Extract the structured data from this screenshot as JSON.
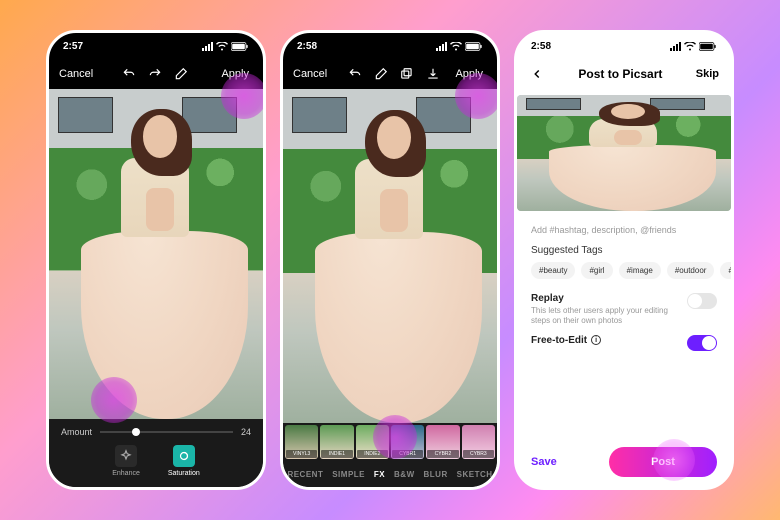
{
  "phone1": {
    "time": "2:57",
    "cancel": "Cancel",
    "apply": "Apply",
    "amount_label": "Amount",
    "amount_value": "24",
    "slider_percent": 24,
    "tools": {
      "enhance": "Enhance",
      "saturation": "Saturation"
    }
  },
  "phone2": {
    "time": "2:58",
    "cancel": "Cancel",
    "apply": "Apply",
    "thumbs": [
      "VINYL3",
      "INDIE1",
      "INDIE2",
      "CYBR1",
      "CYBR2",
      "CYBR3"
    ],
    "categories": [
      "RECENT",
      "SIMPLE",
      "FX",
      "B&W",
      "BLUR",
      "SKETCH"
    ],
    "active_category": "FX"
  },
  "phone3": {
    "time": "2:58",
    "title": "Post to Picsart",
    "skip": "Skip",
    "hashtag_placeholder": "Add #hashtag, description, @friends",
    "suggested_label": "Suggested Tags",
    "tags": [
      "#beauty",
      "#girl",
      "#image",
      "#outdoor",
      "#afternoon"
    ],
    "replay": {
      "title": "Replay",
      "desc": "This lets other users apply your editing steps on their own photos",
      "on": false
    },
    "free_to_edit": {
      "title": "Free-to-Edit",
      "on": true
    },
    "save": "Save",
    "post": "Post"
  },
  "colors": {
    "accent": "#6d1fff",
    "post_grad_a": "#ff2ea6",
    "post_grad_b": "#a020ff"
  }
}
